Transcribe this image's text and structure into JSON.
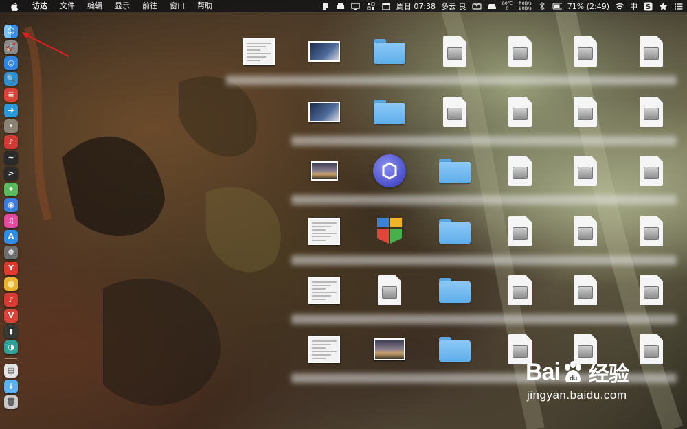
{
  "menubar": {
    "app_name": "访达",
    "menus": [
      "文件",
      "编辑",
      "显示",
      "前往",
      "窗口",
      "帮助"
    ],
    "status": {
      "temp_top": "60℃",
      "temp_bottom": "0",
      "net_up": "↑0B/s",
      "net_down": "↓0B/s",
      "clock": "周日 07:38",
      "weather": "多云 良",
      "battery": "71% (2:49)",
      "input_method": "中"
    }
  },
  "dock": {
    "items": [
      {
        "name": "finder",
        "color": "#3a8ee6",
        "glyph": "☺"
      },
      {
        "name": "launchpad",
        "color": "#8a8a8a",
        "glyph": "🚀"
      },
      {
        "name": "safari",
        "color": "#2f86e4",
        "glyph": "◎"
      },
      {
        "name": "preview",
        "color": "#2e8fcf",
        "glyph": "🔍"
      },
      {
        "name": "notes-red",
        "color": "#d8433a",
        "glyph": "≡"
      },
      {
        "name": "migration",
        "color": "#2c9ad8",
        "glyph": "➜"
      },
      {
        "name": "gray-app",
        "color": "#8a8273",
        "glyph": "•"
      },
      {
        "name": "music-red",
        "color": "#d13b36",
        "glyph": "♪"
      },
      {
        "name": "activity-monitor",
        "color": "#2a2a2a",
        "glyph": "~"
      },
      {
        "name": "terminal",
        "color": "#2b2b2b",
        "glyph": ">"
      },
      {
        "name": "maps",
        "color": "#5bb85c",
        "glyph": "⌖"
      },
      {
        "name": "siri",
        "color": "#3a7de0",
        "glyph": "◉"
      },
      {
        "name": "itunes",
        "color": "#e44a9e",
        "glyph": "♫"
      },
      {
        "name": "app-store",
        "color": "#2f8fe8",
        "glyph": "A"
      },
      {
        "name": "system-preferences",
        "color": "#6f6f6f",
        "glyph": "⚙"
      },
      {
        "name": "yandex",
        "color": "#e03a2e",
        "glyph": "Y"
      },
      {
        "name": "chrome",
        "color": "#e8b32e",
        "glyph": "◍"
      },
      {
        "name": "netease-music",
        "color": "#d73a31",
        "glyph": "♪"
      },
      {
        "name": "vivaldi",
        "color": "#d9433a",
        "glyph": "V"
      },
      {
        "name": "dark-app",
        "color": "#353a35",
        "glyph": "▮"
      },
      {
        "name": "teal-app",
        "color": "#2fa39a",
        "glyph": "◑"
      }
    ],
    "tail": [
      {
        "name": "document-stack",
        "color": "#e4e4e4",
        "glyph": "▤"
      },
      {
        "name": "downloads-folder",
        "color": "#5fb0ee",
        "glyph": "↓"
      },
      {
        "name": "trash",
        "color": "#c9c9c9",
        "glyph": "🗑"
      }
    ]
  },
  "watermark": {
    "brand_a": "Bai",
    "brand_b": "经验",
    "url": "jingyan.baidu.com"
  }
}
